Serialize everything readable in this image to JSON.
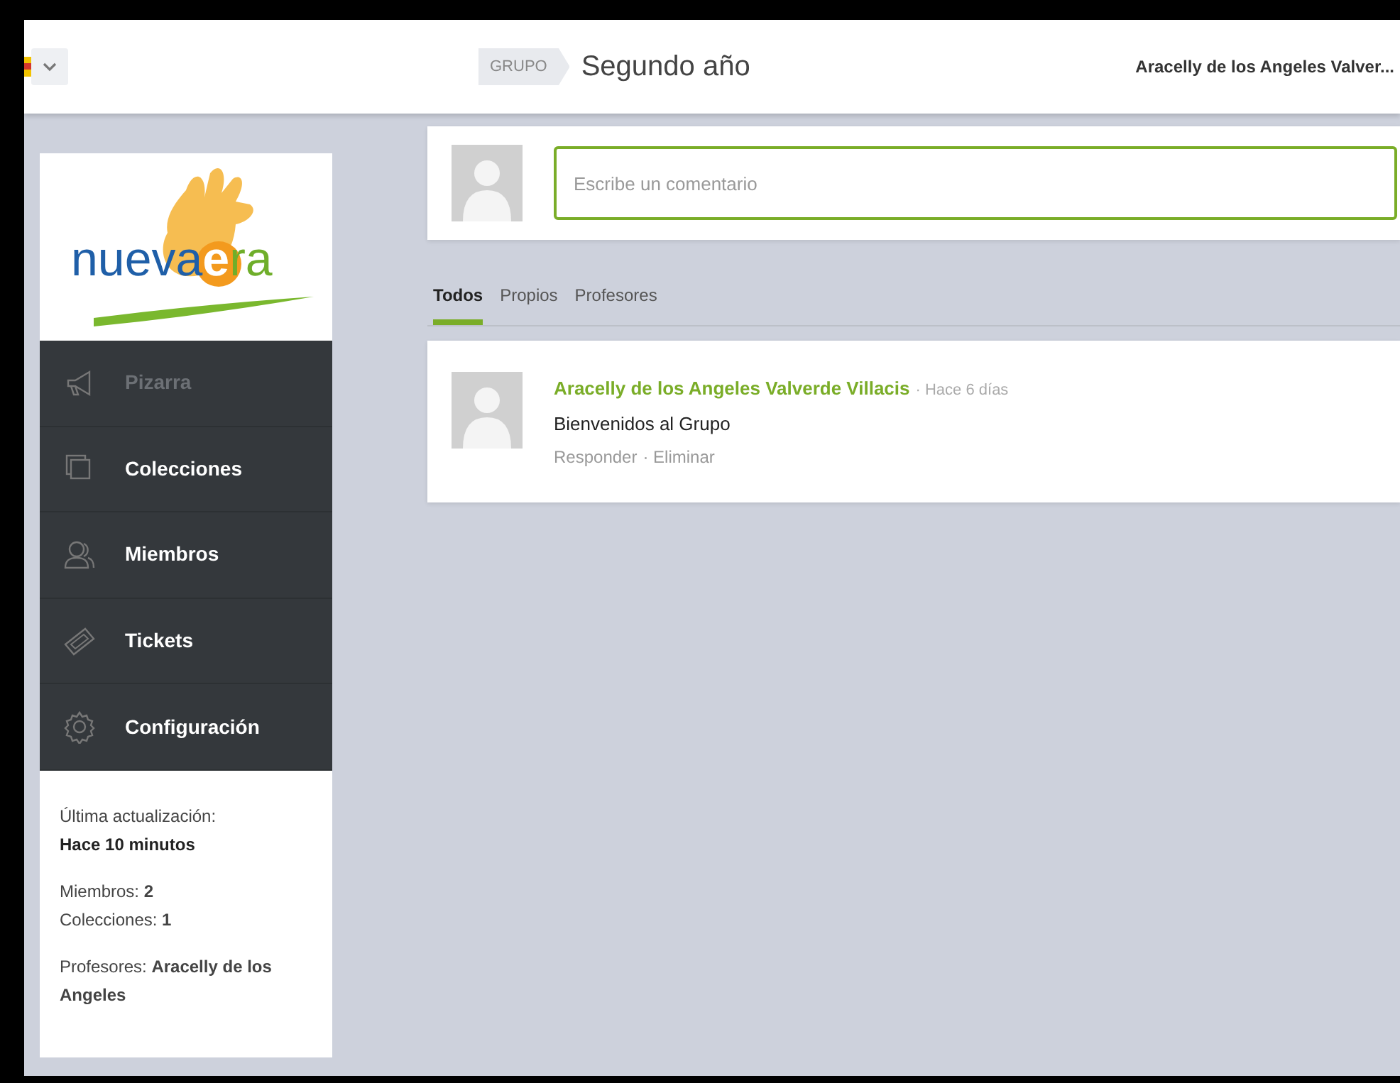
{
  "topbar": {
    "group_tag": "GRUPO",
    "group_name": "Segundo año",
    "user_name": "Aracelly de los Angeles Valver..."
  },
  "sidebar": {
    "logo": {
      "parts": [
        "nueva",
        "e",
        "ra"
      ]
    },
    "items": [
      {
        "label": "Pizarra",
        "selected": true
      },
      {
        "label": "Colecciones",
        "selected": false
      },
      {
        "label": "Miembros",
        "selected": false
      },
      {
        "label": "Tickets",
        "selected": false
      },
      {
        "label": "Configuración",
        "selected": false
      }
    ],
    "info": {
      "updated_label": "Última actualización:",
      "updated_value": "Hace 10 minutos",
      "members": "Miembros: **2**",
      "collections": "Colecciones: **1**",
      "teachers": "Profesores: **Aracelly de los Angeles**"
    }
  },
  "composer": {
    "placeholder": "Escribe un comentario"
  },
  "tabs": [
    {
      "label": "Todos",
      "selected": true
    },
    {
      "label": "Propios",
      "selected": false
    },
    {
      "label": "Profesores",
      "selected": false
    }
  ],
  "posts": [
    {
      "author": "Aracelly de los Angeles Valverde Villacis",
      "time": "· Hace 6 días",
      "text": "Bienvenidos al Grupo",
      "actions": [
        "Responder",
        "· Eliminar"
      ]
    }
  ]
}
